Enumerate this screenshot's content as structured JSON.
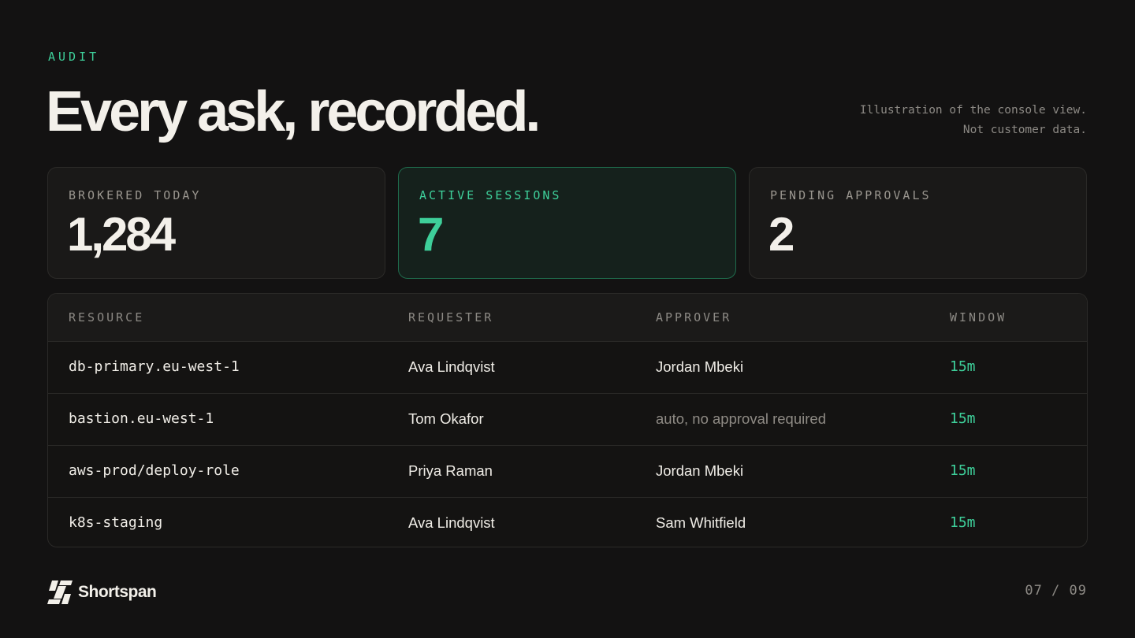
{
  "header": {
    "eyebrow": "AUDIT",
    "title": "Every ask, recorded.",
    "disclaimer_line1": "Illustration of the console view.",
    "disclaimer_line2": "Not customer data."
  },
  "stats": [
    {
      "label": "BROKERED TODAY",
      "value": "1,284",
      "highlighted": false
    },
    {
      "label": "ACTIVE SESSIONS",
      "value": "7",
      "highlighted": true
    },
    {
      "label": "PENDING APPROVALS",
      "value": "2",
      "highlighted": false
    }
  ],
  "table": {
    "columns": {
      "resource": "RESOURCE",
      "requester": "REQUESTER",
      "approver": "APPROVER",
      "window": "WINDOW"
    },
    "rows": [
      {
        "resource": "db-primary.eu-west-1",
        "requester": "Ava Lindqvist",
        "approver": "Jordan Mbeki",
        "window": "15m"
      },
      {
        "resource": "bastion.eu-west-1",
        "requester": "Tom Okafor",
        "approver": "auto, no approval required",
        "window": "15m"
      },
      {
        "resource": "aws-prod/deploy-role",
        "requester": "Priya Raman",
        "approver": "Jordan Mbeki",
        "window": "15m"
      },
      {
        "resource": "k8s-staging",
        "requester": "Ava Lindqvist",
        "approver": "Sam Whitfield",
        "window": "15m"
      }
    ]
  },
  "footer": {
    "brand_name": "Shortspan",
    "brand_icon": "shortspan-logo-icon",
    "page_indicator": "07 / 09"
  },
  "colors": {
    "background": "#131212",
    "accent": "#3ecf9a",
    "text": "#f3f0ea",
    "muted": "#8d8a85"
  }
}
